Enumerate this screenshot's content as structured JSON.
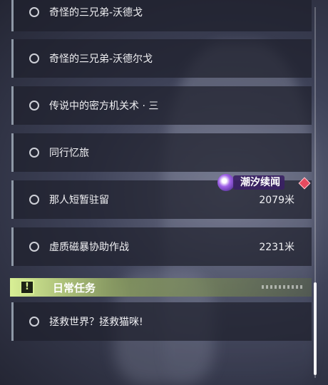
{
  "quests": [
    {
      "title": "奇怪的三兄弟-沃德戈",
      "distance": ""
    },
    {
      "title": "奇怪的三兄弟-沃德尔戈",
      "distance": ""
    },
    {
      "title": "传说中的密方机关术 · 三",
      "distance": ""
    },
    {
      "title": "同行忆旅",
      "distance": ""
    },
    {
      "title": "那人短暂驻留",
      "distance": "2079米"
    },
    {
      "title": "虚质磁暴协助作战",
      "distance": "2231米"
    }
  ],
  "daily": {
    "header_title": "日常任务",
    "header_icon": "!",
    "quests": [
      {
        "title": "拯救世界？拯救猫咪!",
        "distance": ""
      }
    ]
  },
  "watermark": {
    "text": "潮汐续闻"
  },
  "colors": {
    "accent_green": "#d8ef95",
    "row_bar": "#8e98a6",
    "marker_red": "#e84a5f"
  }
}
